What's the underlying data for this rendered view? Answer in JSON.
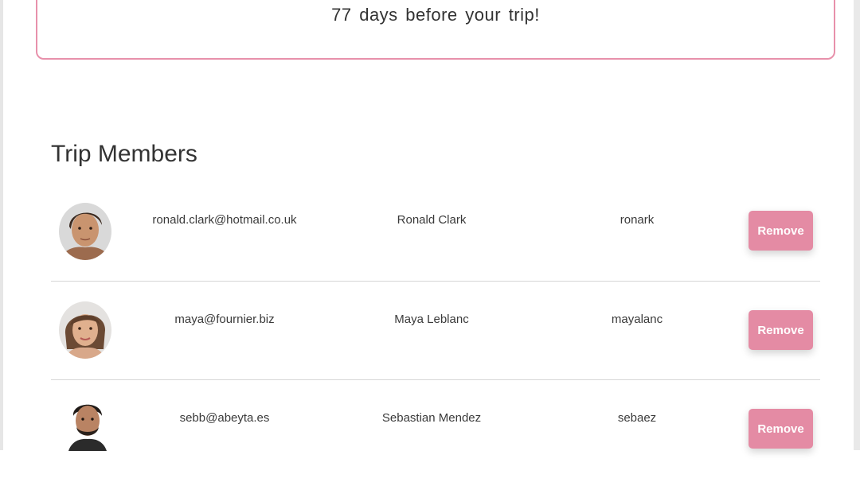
{
  "countdown": {
    "text": "77 days before your trip!"
  },
  "members_section": {
    "title": "Trip Members",
    "remove_label": "Remove",
    "members": [
      {
        "email": "ronald.clark@hotmail.co.uk",
        "name": "Ronald Clark",
        "username": "ronark",
        "avatar_icon": "male-portrait"
      },
      {
        "email": "maya@fournier.biz",
        "name": "Maya Leblanc",
        "username": "mayalanc",
        "avatar_icon": "female-portrait"
      },
      {
        "email": "sebb@abeyta.es",
        "name": "Sebastian Mendez",
        "username": "sebaez",
        "avatar_icon": "male-portrait"
      }
    ]
  },
  "colors": {
    "accent": "#e48ba4",
    "border": "#e891ab"
  }
}
